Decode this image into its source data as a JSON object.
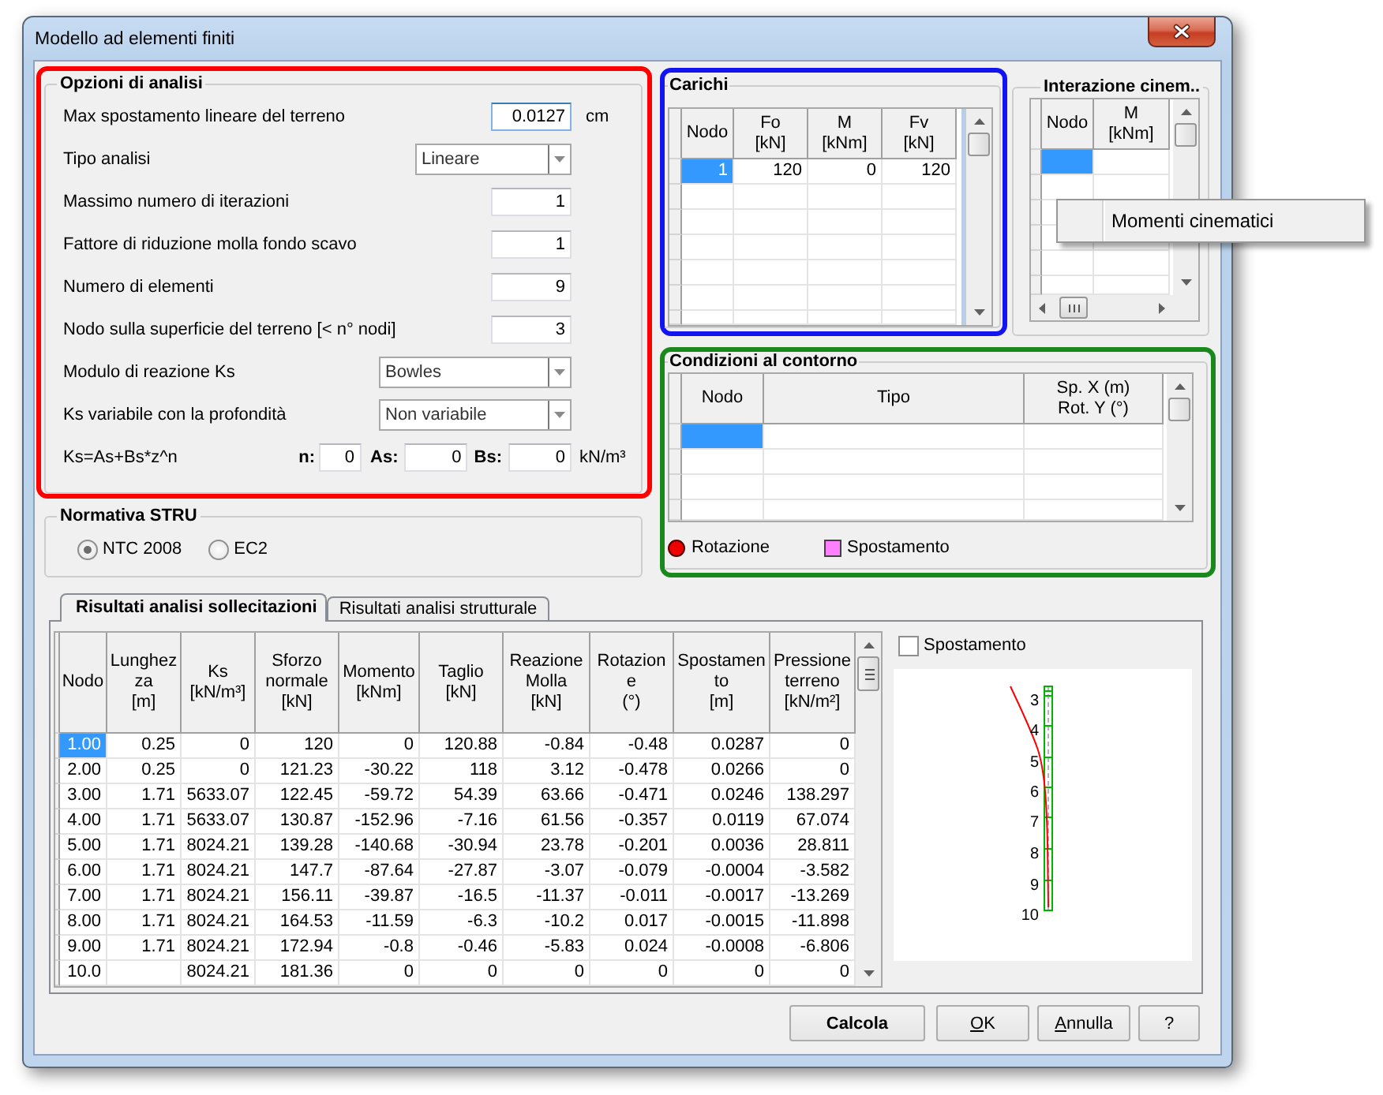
{
  "window": {
    "title": "Modello ad elementi finiti"
  },
  "analysis_options": {
    "title": "Opzioni di analisi",
    "fields": [
      {
        "kind": "input",
        "label": "Max spostamento lineare del terreno",
        "value": "0.0127",
        "unit": "cm",
        "focused": true
      },
      {
        "kind": "dropdown",
        "label": "Tipo analisi",
        "value": "Lineare",
        "focused": false
      },
      {
        "kind": "input",
        "label": "Massimo numero di iterazioni",
        "value": "1",
        "focused": false
      },
      {
        "kind": "input",
        "label": "Fattore di riduzione molla fondo scavo",
        "value": "1",
        "focused": false
      },
      {
        "kind": "input",
        "label": "Numero di elementi",
        "value": "9",
        "focused": false
      },
      {
        "kind": "input",
        "label": "Nodo sulla superficie del terreno [< n° nodi]",
        "value": "3",
        "focused": false
      },
      {
        "kind": "dropdown",
        "label": "Modulo di reazione Ks",
        "value": "Bowles",
        "focused": false
      },
      {
        "kind": "dropdown",
        "label": "Ks variabile con la profondità",
        "value": "Non variabile",
        "focused": false
      }
    ],
    "formula": {
      "label": "Ks=As+Bs*z^n",
      "inputs": [
        {
          "label": "n:",
          "value": "0"
        },
        {
          "label": "As:",
          "value": "0"
        },
        {
          "label": "Bs:",
          "value": "0"
        }
      ],
      "unit": "kN/m³"
    }
  },
  "standard": {
    "title": "Normativa STRU",
    "options": [
      {
        "label": "NTC 2008",
        "selected": true
      },
      {
        "label": "EC2",
        "selected": false
      }
    ]
  },
  "loads": {
    "title": "Carichi",
    "columns": [
      "Nodo",
      "Fo\n[kN]",
      "M\n[kNm]",
      "Fv\n[kN]"
    ],
    "rows": [
      {
        "cells": [
          "1",
          "120",
          "0",
          "120"
        ],
        "selected": true
      }
    ]
  },
  "kinematic_interaction": {
    "title": "Interazione cinem..",
    "columns": [
      "Nodo",
      "M\n[kNm]"
    ],
    "rows": [
      {
        "selected": true
      }
    ]
  },
  "context_menu": {
    "items": [
      "Momenti cinematici"
    ]
  },
  "boundary_conditions": {
    "title": "Condizioni al contorno",
    "columns": [
      "Nodo",
      "Tipo",
      "Sp. X (m)\nRot. Y (°)"
    ],
    "rows": [
      {
        "selected": true
      }
    ],
    "legend": [
      {
        "kind": "circle",
        "label": "Rotazione",
        "color": "#ee0000"
      },
      {
        "kind": "square",
        "label": "Spostamento",
        "color": "#ff80ff"
      }
    ]
  },
  "tabs": [
    {
      "label": "Risultati analisi sollecitazioni",
      "selected": true
    },
    {
      "label": "Risultati analisi strutturale",
      "selected": false
    }
  ],
  "results": {
    "columns": [
      "Nodo",
      "Lunghez\nza\n[m]",
      "Ks\n[kN/m³]",
      "Sforzo\nnormale\n[kN]",
      "Momento\n[kNm]",
      "Taglio\n[kN]",
      "Reazione\nMolla\n[kN]",
      "Rotazion\ne\n(°)",
      "Spostamen\nto\n[m]",
      "Pressione\nterreno\n[kN/m²]"
    ],
    "rows": [
      {
        "cells": [
          "1.00",
          "0.25",
          "0",
          "120",
          "0",
          "120.88",
          "-0.84",
          "-0.48",
          "0.0287",
          "0"
        ],
        "selected": true
      },
      {
        "cells": [
          "2.00",
          "0.25",
          "0",
          "121.23",
          "-30.22",
          "118",
          "3.12",
          "-0.478",
          "0.0266",
          "0"
        ],
        "selected": false
      },
      {
        "cells": [
          "3.00",
          "1.71",
          "5633.07",
          "122.45",
          "-59.72",
          "54.39",
          "63.66",
          "-0.471",
          "0.0246",
          "138.297"
        ],
        "selected": false
      },
      {
        "cells": [
          "4.00",
          "1.71",
          "5633.07",
          "130.87",
          "-152.96",
          "-7.16",
          "61.56",
          "-0.357",
          "0.0119",
          "67.074"
        ],
        "selected": false
      },
      {
        "cells": [
          "5.00",
          "1.71",
          "8024.21",
          "139.28",
          "-140.68",
          "-30.94",
          "23.78",
          "-0.201",
          "0.0036",
          "28.811"
        ],
        "selected": false
      },
      {
        "cells": [
          "6.00",
          "1.71",
          "8024.21",
          "147.7",
          "-87.64",
          "-27.87",
          "-3.07",
          "-0.079",
          "-0.0004",
          "-3.582"
        ],
        "selected": false
      },
      {
        "cells": [
          "7.00",
          "1.71",
          "8024.21",
          "156.11",
          "-39.87",
          "-16.5",
          "-11.37",
          "-0.011",
          "-0.0017",
          "-13.269"
        ],
        "selected": false
      },
      {
        "cells": [
          "8.00",
          "1.71",
          "8024.21",
          "164.53",
          "-11.59",
          "-6.3",
          "-10.2",
          "0.017",
          "-0.0015",
          "-11.898"
        ],
        "selected": false
      },
      {
        "cells": [
          "9.00",
          "1.71",
          "8024.21",
          "172.94",
          "-0.8",
          "-0.46",
          "-5.83",
          "0.024",
          "-0.0008",
          "-6.806"
        ],
        "selected": false
      },
      {
        "cells": [
          "10.0",
          null,
          "8024.21",
          "181.36",
          "0",
          "0",
          "0",
          "0",
          "0",
          "0"
        ],
        "selected": false
      }
    ]
  },
  "diagram": {
    "checkbox": {
      "label": "Spostamento",
      "checked": false
    },
    "node_labels": [
      "3",
      "4",
      "5",
      "6",
      "7",
      "8",
      "9",
      "10"
    ]
  },
  "buttons": [
    {
      "label": "Calcola",
      "default": true,
      "access_key_underlined": false
    },
    {
      "label": "OK",
      "default": false,
      "access_key_underlined": true
    },
    {
      "label": "Annulla",
      "default": false,
      "access_key_underlined": true
    },
    {
      "label": "?",
      "default": false,
      "access_key_underlined": false
    }
  ]
}
